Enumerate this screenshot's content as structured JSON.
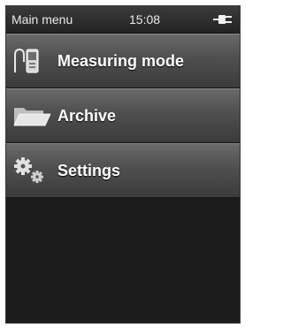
{
  "status_bar": {
    "title": "Main menu",
    "time": "15:08",
    "power_icon": "plug-icon"
  },
  "menu": {
    "items": [
      {
        "label": "Measuring mode",
        "icon": "measuring-device-icon"
      },
      {
        "label": "Archive",
        "icon": "folder-icon"
      },
      {
        "label": "Settings",
        "icon": "gears-icon"
      }
    ]
  },
  "colors": {
    "background": "#1b1b1b",
    "menu_item_top": "#6a6a6a",
    "menu_item_bottom": "#3b3b3b",
    "text": "#ffffff"
  }
}
